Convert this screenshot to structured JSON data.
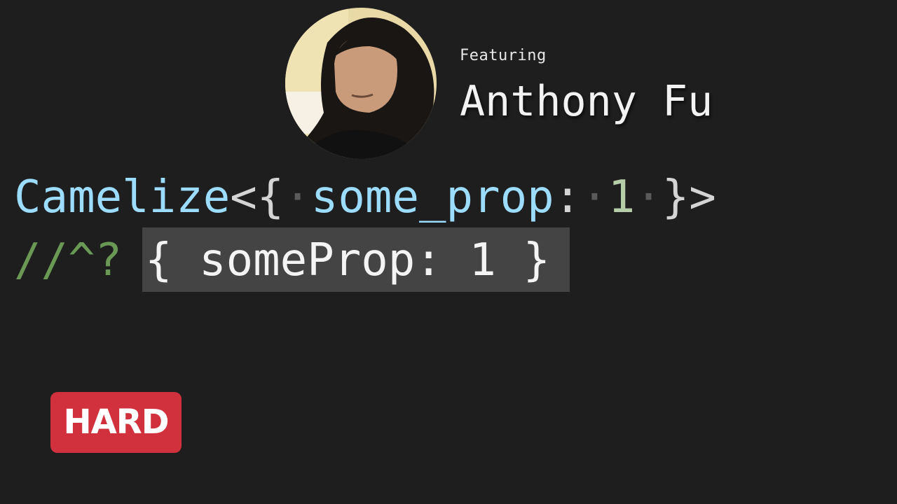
{
  "header": {
    "featuring_label": "Featuring",
    "author_name": "Anthony Fu"
  },
  "code": {
    "line1": {
      "type_name": "Camelize",
      "open_angle": "<{",
      "prop_name": "some_prop",
      "colon": ":",
      "value": "1",
      "close": "}>"
    },
    "line2": {
      "comment": "//^?",
      "hint": "{ someProp: 1 }"
    }
  },
  "badge": {
    "label": "HARD",
    "color": "#d1313d"
  },
  "colors": {
    "background": "#1e1e1e",
    "type": "#9cdcfe",
    "number": "#b5cea8",
    "comment": "#6a9955",
    "hint_background": "#444444"
  }
}
